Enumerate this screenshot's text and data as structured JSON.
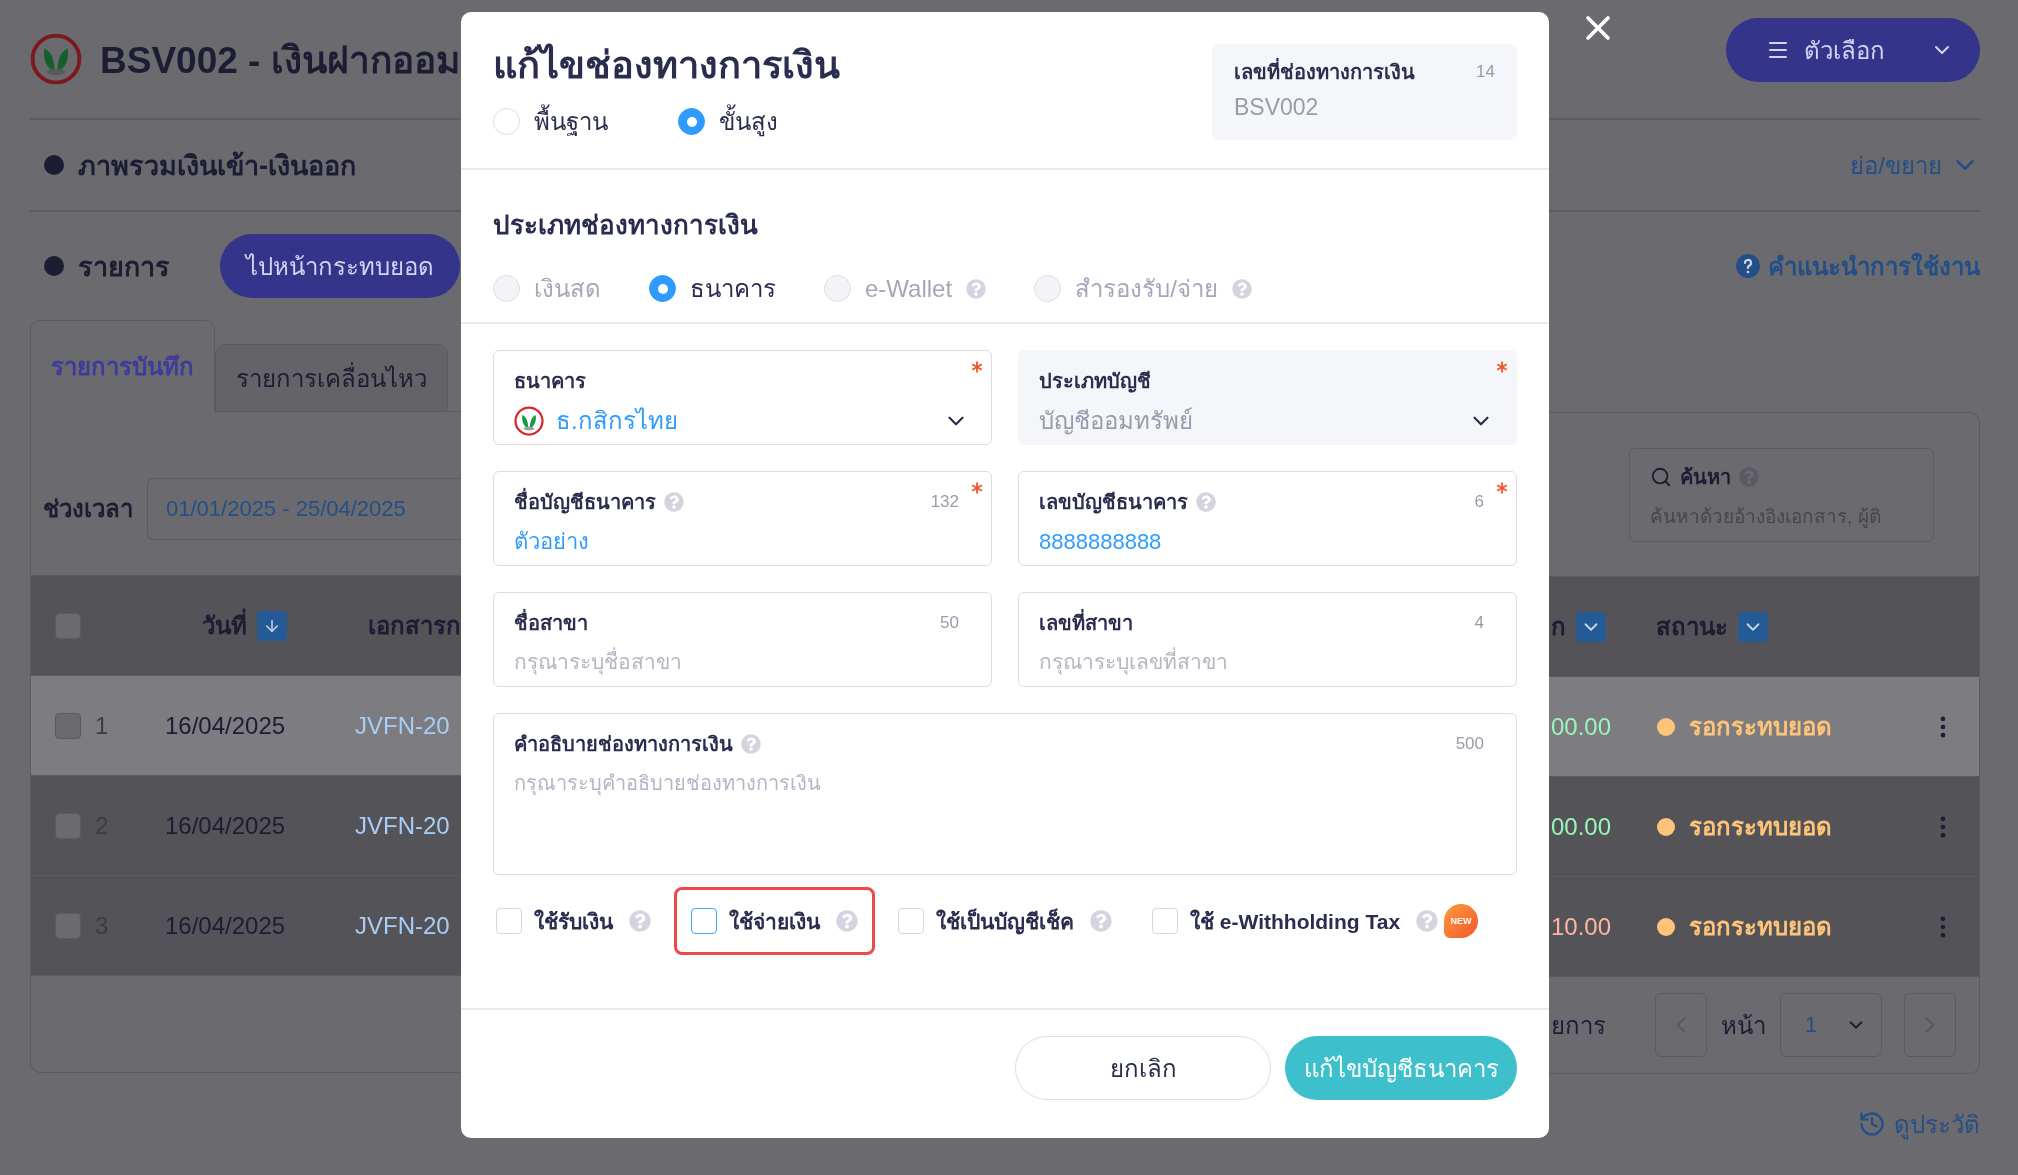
{
  "page": {
    "title": "BSV002 - เงินฝากออม",
    "options_button": "ตัวเลือก",
    "overview": {
      "label": "ภาพรวมเงินเข้า-เงินออก",
      "toggle": "ย่อ/ขยาย"
    },
    "list": {
      "label": "รายการ",
      "reconcile_button": "ไปหน้ากระทบยอด",
      "help_link": "คำแนะนำการใช้งาน"
    },
    "tabs": [
      {
        "label": "รายการบันทึก",
        "selected": true
      },
      {
        "label": "รายการเคลื่อนไหว",
        "selected": false
      }
    ],
    "period": {
      "label": "ช่วงเวลา",
      "value": "01/01/2025 - 25/04/2025"
    },
    "search": {
      "label": "ค้นหา",
      "placeholder": "ค้นหาด้วยอ้างอิงเอกสาร, ผู้ติ"
    },
    "table": {
      "all_checked": false,
      "left_columns": [
        {
          "label": "วันที่",
          "kind": "sort"
        },
        {
          "label": "เอกสารก",
          "kind": "plain"
        }
      ],
      "right_columns": [
        {
          "label": "ก",
          "kind": "filter"
        },
        {
          "label": "สถานะ",
          "kind": "filter"
        }
      ],
      "rows": [
        {
          "checked": false,
          "highlighted": true,
          "number": "1",
          "date": "16/04/2025",
          "document": "JVFN-20",
          "amount": {
            "text": "00.00",
            "color": "#9af5b8"
          },
          "status": {
            "text": "รอกระทบยอด",
            "color": "#ffc47a"
          }
        },
        {
          "checked": false,
          "highlighted": false,
          "number": "2",
          "date": "16/04/2025",
          "document": "JVFN-20",
          "amount": {
            "text": "00.00",
            "color": "#9af5b8"
          },
          "status": {
            "text": "รอกระทบยอด",
            "color": "#ffc47a"
          }
        },
        {
          "checked": false,
          "highlighted": false,
          "number": "3",
          "date": "16/04/2025",
          "document": "JVFN-20",
          "amount": {
            "text": "10.00",
            "color": "#ffb4a4"
          },
          "status": {
            "text": "รอกระทบยอด",
            "color": "#ffc47a"
          }
        }
      ]
    },
    "pagination": {
      "label": "ยการ",
      "page_label": "หน้า",
      "page": "1"
    },
    "history_link": "ดูประวัติ"
  },
  "dialog": {
    "title": "แก้ไขช่องทางการเงิน",
    "modes": [
      {
        "label": "พื้นฐาน",
        "selected": false
      },
      {
        "label": "ขั้นสูง",
        "selected": true
      }
    ],
    "code_field": {
      "label": "เลขที่ช่องทางการเงิน",
      "counter": "14",
      "value": "BSV002"
    },
    "type_section": {
      "title": "ประเภทช่องทางการเงิน",
      "options": [
        {
          "label": "เงินสด",
          "selected": false,
          "disabled": true,
          "help": false
        },
        {
          "label": "ธนาคาร",
          "selected": true,
          "disabled": false,
          "help": false
        },
        {
          "label": "e-Wallet",
          "selected": false,
          "disabled": true,
          "help": true
        },
        {
          "label": "สำรองรับ/จ่าย",
          "selected": false,
          "disabled": true,
          "help": true
        }
      ]
    },
    "fields": [
      {
        "kind": "select",
        "label": "ธนาคาร",
        "required": true,
        "help": false,
        "logo": true,
        "disabled": false,
        "value": "ธ.กสิกรไทย"
      },
      {
        "kind": "select",
        "label": "ประเภทบัญชี",
        "required": true,
        "help": false,
        "logo": false,
        "disabled": true,
        "value": "บัญชีออมทรัพย์"
      },
      {
        "kind": "text",
        "label": "ชื่อบัญชีธนาคาร",
        "required": true,
        "help": true,
        "counter": "132",
        "value": "ตัวอย่าง"
      },
      {
        "kind": "text",
        "label": "เลขบัญชีธนาคาร",
        "required": true,
        "help": true,
        "counter": "6",
        "value": "8888888888"
      },
      {
        "kind": "text",
        "label": "ชื่อสาขา",
        "required": false,
        "help": false,
        "counter": "50",
        "placeholder": "กรุณาระบุชื่อสาขา"
      },
      {
        "kind": "text",
        "label": "เลขที่สาขา",
        "required": false,
        "help": false,
        "counter": "4",
        "placeholder": "กรุณาระบุเลขที่สาขา"
      },
      {
        "kind": "textarea",
        "label": "คำอธิบายช่องทางการเงิน",
        "required": false,
        "help": true,
        "counter": "500",
        "placeholder": "กรุณาระบุคำอธิบายช่องทางการเงิน"
      }
    ],
    "checkboxes": [
      {
        "label": "ใช้รับเงิน",
        "checked": false,
        "highlighted": false,
        "help": true
      },
      {
        "label": "ใช้จ่ายเงิน",
        "checked": false,
        "highlighted": true,
        "help": true
      },
      {
        "label": "ใช้เป็นบัญชีเช็ค",
        "checked": false,
        "highlighted": false,
        "help": true
      },
      {
        "label": "ใช้ e-Withholding Tax",
        "checked": false,
        "highlighted": false,
        "help": true,
        "badge": "NEW"
      }
    ],
    "buttons": [
      {
        "label": "ยกเลิก",
        "kind": "secondary"
      },
      {
        "label": "แก้ไขบัญชีธนาคาร",
        "kind": "primary"
      }
    ]
  }
}
